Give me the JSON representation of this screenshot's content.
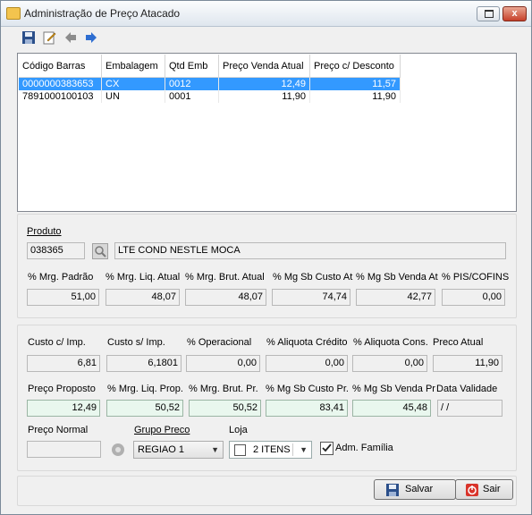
{
  "window": {
    "title": "Administração de Preço Atacado",
    "close_label": "x"
  },
  "grid": {
    "columns": [
      "Código Barras",
      "Embalagem",
      "Qtd Emb",
      "Preço Venda Atual",
      "Preço c/ Desconto"
    ],
    "rows": [
      [
        "0000000383653",
        "CX",
        "0012",
        "12,49",
        "11,57"
      ],
      [
        "7891000100103",
        "UN",
        "0001",
        "11,90",
        "11,90"
      ]
    ]
  },
  "produto": {
    "label": "Produto",
    "code": "038365",
    "description": "LTE COND NESTLE MOCA",
    "labels": [
      "% Mrg. Padrão",
      "% Mrg. Liq. Atual",
      "% Mrg. Brut. Atual",
      "% Mg Sb Custo At",
      "% Mg Sb Venda At",
      "% PIS/COFINS"
    ],
    "values": [
      "51,00",
      "48,07",
      "48,07",
      "74,74",
      "42,77",
      "0,00"
    ]
  },
  "custos": {
    "labels": [
      "Custo c/ Imp.",
      "Custo s/ Imp.",
      "% Operacional",
      "% Aliquota Crédito",
      "% Aliquota Cons.",
      "Preco Atual"
    ],
    "values": [
      "6,81",
      "6,1801",
      "0,00",
      "0,00",
      "0,00",
      "11,90"
    ]
  },
  "proposto": {
    "labels": [
      "Preço Proposto",
      "% Mrg. Liq. Prop.",
      "% Mrg. Brut. Pr.",
      "% Mg Sb Custo Pr.",
      "% Mg Sb Venda Pr",
      "Data Validade"
    ],
    "values": [
      "12,49",
      "50,52",
      "50,52",
      "83,41",
      "45,48",
      "/ /"
    ]
  },
  "bottom": {
    "preco_normal_label": "Preço Normal",
    "preco_normal_value": "",
    "grupo_preco_label": "Grupo Preco",
    "grupo_preco_value": "REGIAO 1",
    "loja_label": "Loja",
    "loja_value": "2 ITENS",
    "adm_familia_label": "Adm. Família",
    "adm_familia_checked": true
  },
  "buttons": {
    "salvar": "Salvar",
    "sair": "Sair"
  },
  "colors": {
    "selection": "#3399ff",
    "green_field": "#e9f7ee"
  }
}
